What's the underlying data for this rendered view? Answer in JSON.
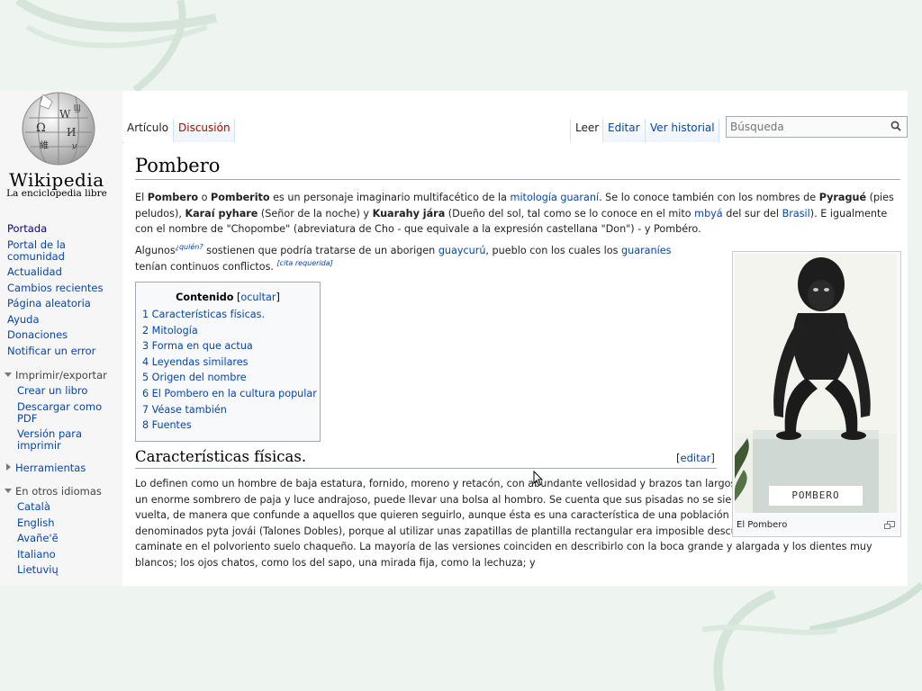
{
  "logo": {
    "wordmark": "Wikipedia",
    "tagline": "La enciclopedia libre"
  },
  "nav": {
    "items": [
      "Portada",
      "Portal de la comunidad",
      "Actualidad",
      "Cambios recientes",
      "Página aleatoria",
      "Ayuda",
      "Donaciones",
      "Notificar un error"
    ]
  },
  "print": {
    "heading": "Imprimir/exportar",
    "items": [
      "Crear un libro",
      "Descargar como PDF",
      "Versión para imprimir"
    ]
  },
  "tools": {
    "heading": "Herramientas"
  },
  "languages": {
    "heading": "En otros idiomas",
    "items": [
      "Català",
      "English",
      "Avañe'ẽ",
      "Italiano",
      "Lietuvių"
    ]
  },
  "tabs": {
    "article": "Artículo",
    "discussion": "Discusión",
    "read": "Leer",
    "edit": "Editar",
    "history": "Ver historial"
  },
  "search": {
    "placeholder": "Búsqueda"
  },
  "article": {
    "title": "Pombero",
    "intro": {
      "p1_a": "El ",
      "p1_b": "Pombero",
      "p1_c": " o ",
      "p1_d": "Pomberito",
      "p1_e": " es un personaje imaginario multifacético de la ",
      "p1_link1": "mitología guaraní",
      "p1_f": ". Se lo conoce también con los nombres de ",
      "p1_g": "Pyragué",
      "p1_h": " (pies peludos), ",
      "p1_i": "Karaí pyhare",
      "p1_j": " (Señor de la noche) y ",
      "p1_k": "Kuarahy jára",
      "p1_l": " (Dueño del sol, tal como se lo conoce en el mito ",
      "p1_link2": "mbyá",
      "p1_m": " del sur del ",
      "p1_link3": "Brasil",
      "p1_n": "). E igualmente con el nombre de \"Chopombe\" (abreviatura de Cho - que equivale a la expresión castellana \"Don\") - y Pombéro.",
      "p2_a": "Algunos",
      "p2_cite1": "¿quién?",
      "p2_b": " sostienen que podría tratarse de un aborigen ",
      "p2_link1": "guaycurú",
      "p2_c": ", pueblo con los cuales los ",
      "p2_link2": "guaraníes",
      "p2_d": " tenían continuos conflictos.",
      "p2_cite2": "cita requerida"
    },
    "toc": {
      "title": "Contenido",
      "toggle": "ocultar",
      "items": [
        "1 Características físicas.",
        "2 Mitología",
        "3 Forma en que actua",
        "4 Leyendas similares",
        "5 Origen del nombre",
        "6 El Pombero en la cultura popular",
        "7 Véase también",
        "8 Fuentes"
      ]
    },
    "section1": {
      "heading": "Características físicas.",
      "edit": "editar",
      "text": "Lo definen como un hombre de baja estatura, fornido, moreno y retacón, con abundante vellosidad y brazos tan largos que los arrastra. A veces usa un enorme sombrero de paja y luce andrajoso, puede llevar una bolsa al hombro. Se cuenta que sus pisadas no se sienten. Sus pies se pueden dar la vuelta, de manera que confunde a aquellos que quieren seguirlo, aunque ésta es una característica de una población indígena del Chaco paraguayo denominados pyta jovái (Talones Dobles), porque al utilizar unas zapatillas de plantilla rectangular era imposible descubrir hacia donde se dirigía en caminate en el polvoriento suelo chaqueño. La mayoría de las versiones coinciden en describirlo con la boca grande y alargada y los dientes muy blancos; los ojos chatos, como los del sapo, una mirada fija, como la lechuza; y"
    },
    "figure": {
      "caption": "El Pombero",
      "plaque": "POMBERO"
    }
  }
}
